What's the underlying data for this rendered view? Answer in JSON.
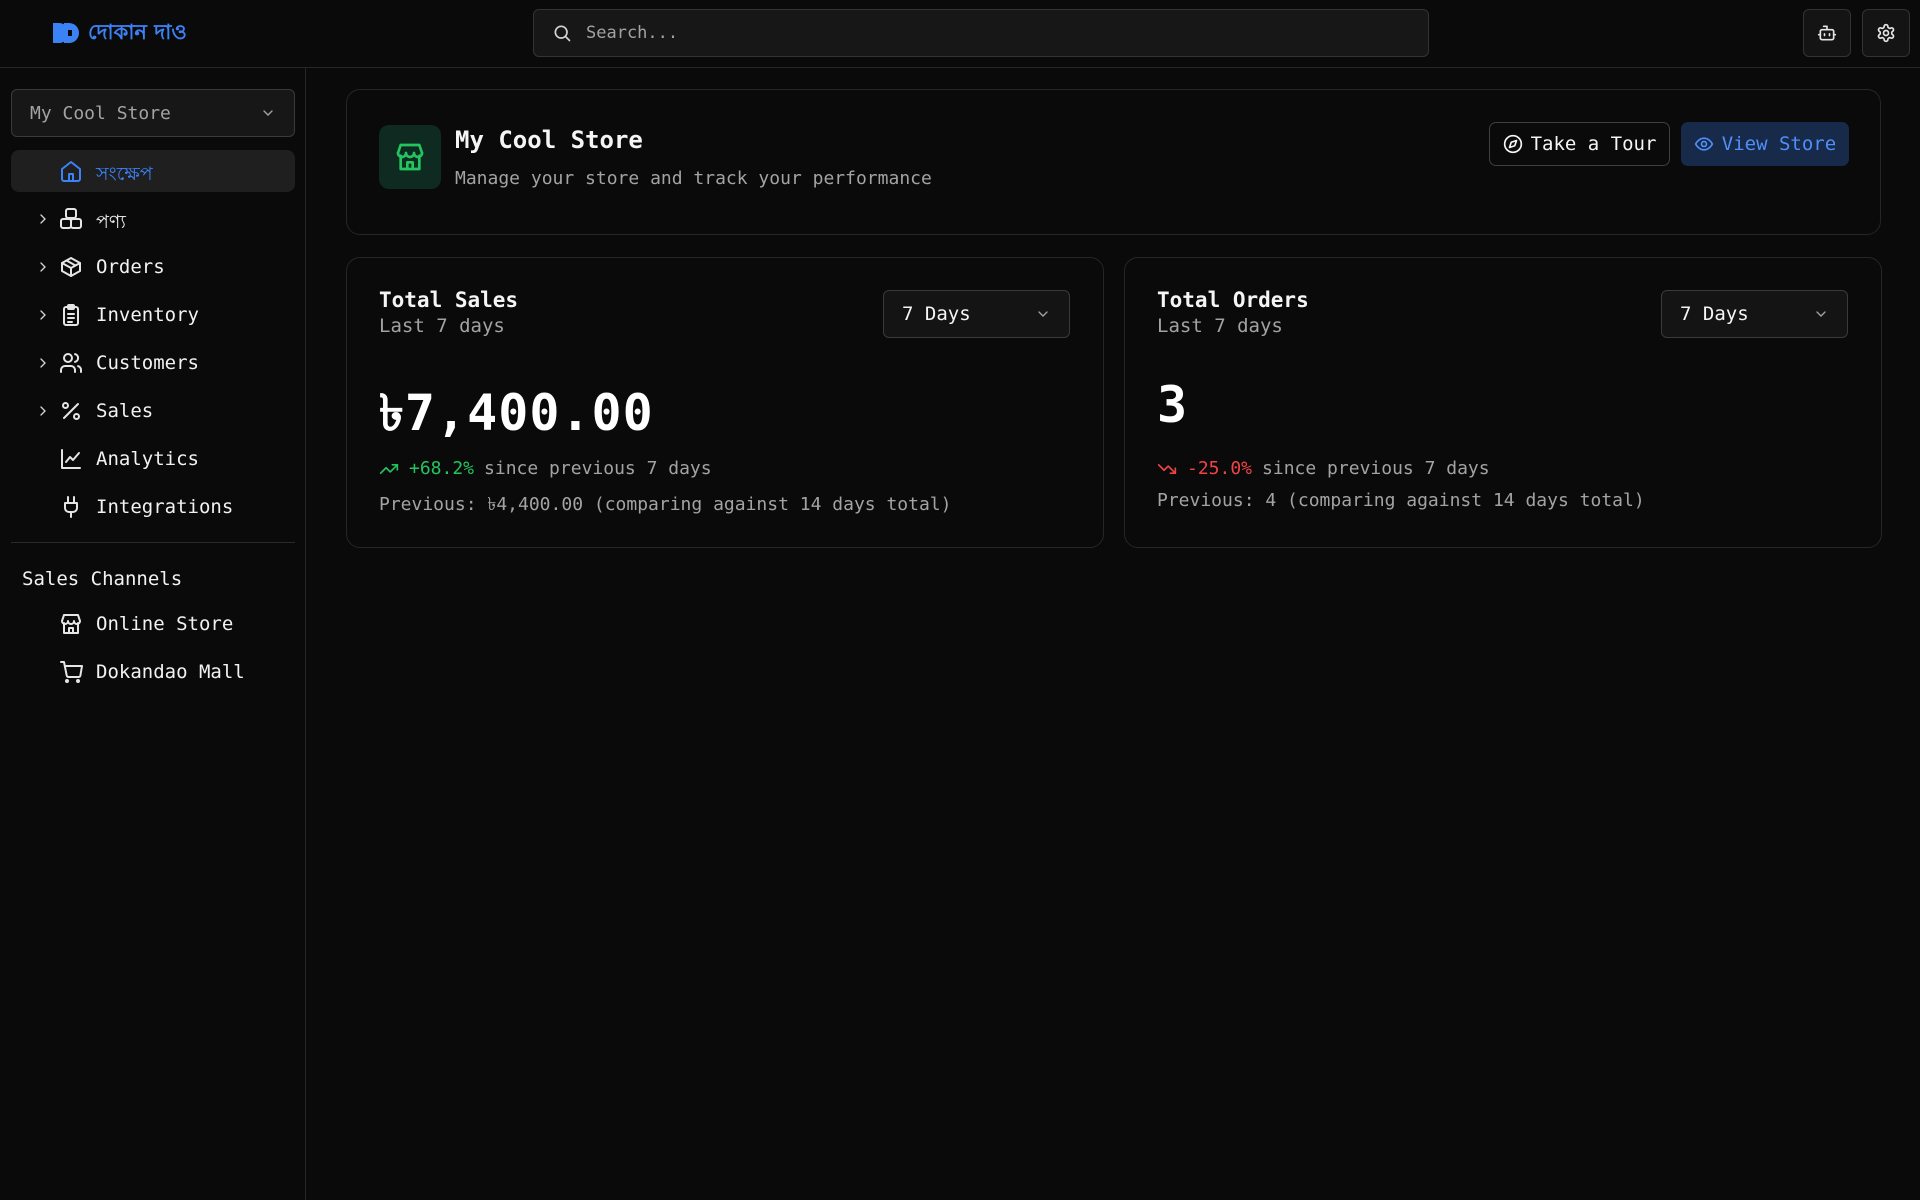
{
  "header": {
    "brand_name": "দোকান দাও",
    "search_placeholder": "Search...",
    "buttons": [
      "robot-icon",
      "gear-icon"
    ]
  },
  "sidebar": {
    "store_selector": "My Cool Store",
    "items": [
      {
        "label": "সংক্ষেপ",
        "icon": "home-icon",
        "active": true,
        "expandable": false
      },
      {
        "label": "পণ্য",
        "icon": "products-icon",
        "active": false,
        "expandable": true
      },
      {
        "label": "Orders",
        "icon": "package-icon",
        "active": false,
        "expandable": true
      },
      {
        "label": "Inventory",
        "icon": "clipboard-icon",
        "active": false,
        "expandable": true
      },
      {
        "label": "Customers",
        "icon": "users-icon",
        "active": false,
        "expandable": true
      },
      {
        "label": "Sales",
        "icon": "percent-icon",
        "active": false,
        "expandable": true
      },
      {
        "label": "Analytics",
        "icon": "line-chart-icon",
        "active": false,
        "expandable": false
      },
      {
        "label": "Integrations",
        "icon": "plug-icon",
        "active": false,
        "expandable": false
      }
    ],
    "channels_title": "Sales Channels",
    "channels": [
      {
        "label": "Online Store",
        "icon": "store-icon"
      },
      {
        "label": "Dokandao Mall",
        "icon": "cart-icon"
      }
    ]
  },
  "store_card": {
    "name": "My Cool Store",
    "description": "Manage your store and track your performance",
    "tour_label": "Take a Tour",
    "view_label": "View Store"
  },
  "metrics": {
    "sales": {
      "title": "Total Sales",
      "subtitle": "Last 7 days",
      "period": "7 Days",
      "value": "৳7,400.00",
      "change": "+68.2%",
      "change_suffix": "since previous 7 days",
      "previous": "Previous: ৳4,400.00 (comparing against 14 days total)"
    },
    "orders": {
      "title": "Total Orders",
      "subtitle": "Last 7 days",
      "period": "7 Days",
      "value": "3",
      "change": "-25.0%",
      "change_suffix": "since previous 7 days",
      "previous": "Previous: 4 (comparing against 14 days total)"
    }
  },
  "colors": {
    "accent": "#3b82f6",
    "positive": "#22c55e",
    "negative": "#ef4444",
    "background": "#0a0a0a"
  }
}
